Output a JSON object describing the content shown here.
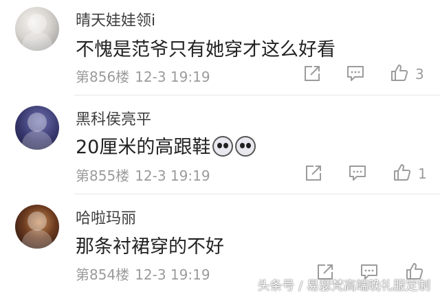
{
  "comments": [
    {
      "username": "晴天娃娃领i",
      "content": "不愧是范爷只有她穿才这么好看",
      "floor": "第856楼",
      "time": "12-3 19:19",
      "likes": "3"
    },
    {
      "username": "黑科侯亮平",
      "content": "20厘米的高跟鞋",
      "floor": "第855楼",
      "time": "12-3 19:19",
      "likes": "1"
    },
    {
      "username": "哈啦玛丽",
      "content": "那条衬裙穿的不好",
      "floor": "第854楼",
      "time": "12-3 19:19",
      "likes": ""
    }
  ],
  "icons": {
    "share": "share-icon",
    "reply": "comment-icon",
    "like": "thumbs-up-icon",
    "emoji": "dog-face-emoji"
  },
  "watermark": "头条号 / 易瑟梵高端晚礼服定制"
}
